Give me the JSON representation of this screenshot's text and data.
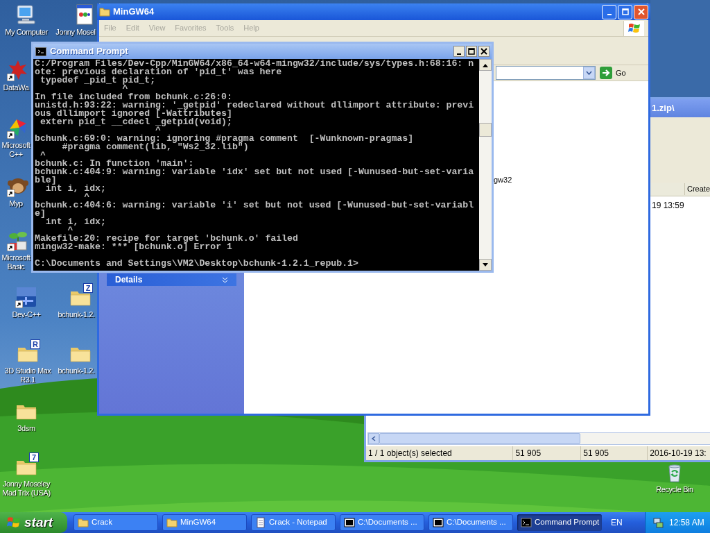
{
  "desktop_icons": [
    {
      "kind": "computer",
      "label": [
        "My Computer"
      ]
    },
    {
      "kind": "app-window",
      "label": [
        "Jonny Mosel"
      ]
    },
    {
      "kind": "starburst",
      "shortcut": true,
      "label": [
        "DataWa"
      ]
    },
    {
      "kind": "pinwheel",
      "shortcut": true,
      "label": [
        "Microsoft",
        "C++"
      ]
    },
    {
      "kind": "animal",
      "shortcut": true,
      "label": [
        "Myp"
      ]
    },
    {
      "kind": "plant",
      "shortcut": true,
      "label": [
        "Microsoft",
        "Basic"
      ]
    },
    {
      "kind": "dev",
      "shortcut": true,
      "label": [
        "Dev-C++"
      ]
    },
    {
      "kind": "folder",
      "badge": "Z",
      "label": [
        "bchunk-1.2."
      ]
    },
    {
      "kind": "folder",
      "badge": "R",
      "label": [
        "3D Studio Max",
        "R3.1"
      ]
    },
    {
      "kind": "folder",
      "label": [
        "bchunk-1.2."
      ]
    },
    {
      "kind": "folder",
      "label": [
        "3dsm"
      ]
    },
    {
      "kind": "folder",
      "badge": "7",
      "label": [
        "Jonny Moseley",
        "Mad Trix (USA)"
      ]
    },
    {
      "kind": "recycle-bin",
      "label": [
        "Recycle Bin"
      ]
    }
  ],
  "archive_window": {
    "title": "1.zip\\",
    "column_heading": "Create",
    "row_cell": "19 13:59",
    "status_bar": [
      "1 / 1 object(s) selected",
      "51 905",
      "51 905",
      "2016-10-19 13:"
    ]
  },
  "explorer_window": {
    "title": "MinGW64",
    "menu": [
      "File",
      "Edit",
      "View",
      "Favorites",
      "Tools",
      "Help"
    ],
    "go_label": "Go",
    "task_pane": [
      {
        "title": "Details",
        "expanded": false
      }
    ],
    "file_name": "gw32"
  },
  "console_window": {
    "title": "Command Prompt",
    "lines": [
      {
        "text": "C:/Program Files/Dev-Cpp/MinGW64/x86_64-w64-mingw32/include/sys/types.h:68:16: n"
      },
      {
        "text": "ote: previous declaration of 'pid_t' was here"
      },
      {
        "text": " typedef _pid_t pid_t;"
      },
      {
        "text": "                ^"
      },
      {
        "text": "In file included from bchunk.c:26:0:"
      },
      {
        "text": "unistd.h:93:22: warning: '_getpid' redeclared without dllimport attribute: previ"
      },
      {
        "text": "ous dllimport ignored [-Wattributes]"
      },
      {
        "text": " extern pid_t __cdecl _getpid(void);"
      },
      {
        "text": "                      ^"
      },
      {
        "text": "bchunk.c:69:0: warning: ignoring #pragma comment  [-Wunknown-pragmas]"
      },
      {
        "text": "     #pragma comment(lib, \"Ws2_32.lib\")"
      },
      {
        "text": " ^"
      },
      {
        "text": "bchunk.c: In function 'main':"
      },
      {
        "text": "bchunk.c:404:9: warning: variable 'idx' set but not used [-Wunused-but-set-varia"
      },
      {
        "text": "ble]"
      },
      {
        "text": "  int i, idx;"
      },
      {
        "text": "         ^"
      },
      {
        "text": "bchunk.c:404:6: warning: variable 'i' set but not used [-Wunused-but-set-variabl"
      },
      {
        "text": "e]"
      },
      {
        "text": "  int i, idx;"
      },
      {
        "text": "      ^"
      },
      {
        "text": "Makefile:20: recipe for target 'bchunk.o' failed"
      },
      {
        "text": "mingw32-make: *** [bchunk.o] Error 1"
      },
      {
        "text": "C:\\Documents and Settings\\VM2\\Desktop\\bchunk-1.2.1_repub.1>",
        "blank_before": true
      }
    ]
  },
  "taskbar": {
    "start_label": "start",
    "tasks": [
      {
        "kind": "folder",
        "label": "Crack",
        "selected": false
      },
      {
        "kind": "folder",
        "label": "MinGW64",
        "selected": false
      },
      {
        "kind": "notepad",
        "label": "Crack - Notepad",
        "selected": false
      },
      {
        "kind": "archive",
        "label": "C:\\Documents ...",
        "selected": false
      },
      {
        "kind": "archive",
        "label": "C:\\Documents ...",
        "selected": false
      },
      {
        "kind": "console",
        "label": "Command Prompt",
        "selected": true
      }
    ],
    "language": "EN",
    "clock": "12:58 AM"
  }
}
